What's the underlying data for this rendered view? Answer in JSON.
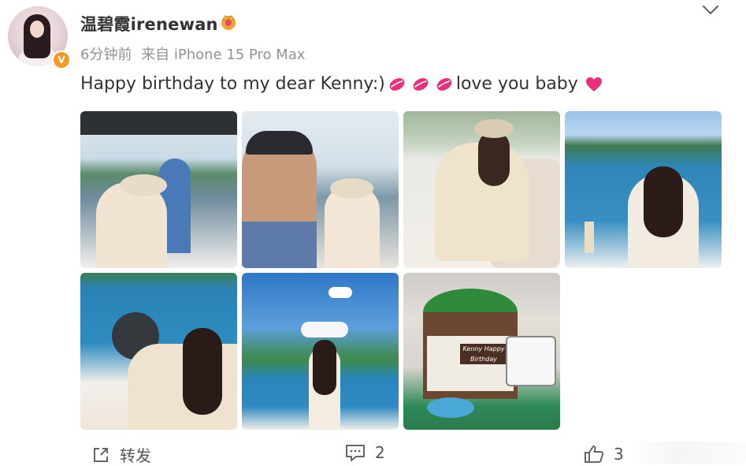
{
  "user": {
    "name": "温碧霞irenewan",
    "verified_badge": "V",
    "source_time": "6分钟前",
    "source_from": "来自 iPhone 15 Pro Max"
  },
  "post": {
    "text": "Happy birthday to my dear Kenny:)",
    "text_after": "love you baby",
    "photos": [
      "photo-1",
      "photo-2",
      "photo-3",
      "photo-4",
      "photo-5",
      "photo-6",
      "photo-7"
    ],
    "cake_text": "Kenny Happy Birthday"
  },
  "actions": {
    "repost_label": "转发",
    "comment_count": "2",
    "like_count": "3"
  },
  "colors": {
    "accent": "#f59a23",
    "text": "#333333",
    "meta": "#939393",
    "lips": "#e8317d",
    "heart": "#e8317d"
  }
}
